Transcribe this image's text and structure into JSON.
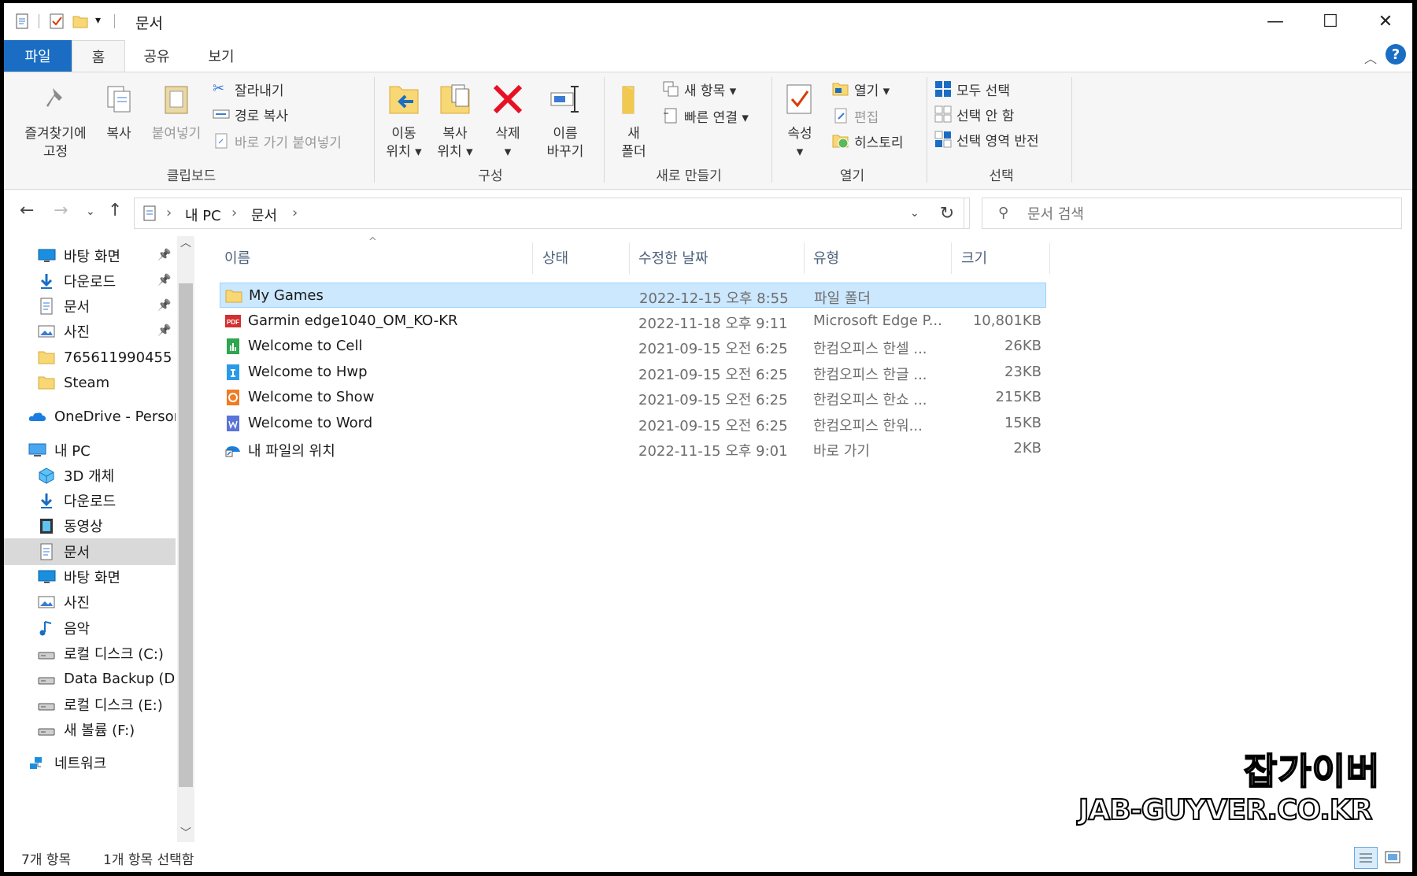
{
  "window": {
    "title": "문서",
    "minimize": "—",
    "maximize": "☐",
    "close": "✕"
  },
  "tabs": {
    "file": "파일",
    "home": "홈",
    "share": "공유",
    "view": "보기"
  },
  "ribbon": {
    "clipboard": {
      "label": "클립보드",
      "pin_line1": "즐겨찾기에",
      "pin_line2": "고정",
      "copy": "복사",
      "paste": "붙여넣기",
      "cut": "잘라내기",
      "copy_path": "경로 복사",
      "paste_shortcut": "바로 가기 붙여넣기"
    },
    "organize": {
      "label": "구성",
      "move_line1": "이동",
      "move_line2": "위치 ▾",
      "copyto_line1": "복사",
      "copyto_line2": "위치 ▾",
      "delete": "삭제",
      "delete_arrow": "▾",
      "rename_line1": "이름",
      "rename_line2": "바꾸기"
    },
    "new": {
      "label": "새로 만들기",
      "folder_line1": "새",
      "folder_line2": "폴더",
      "new_item": "새 항목 ▾",
      "easy_access": "빠른 연결 ▾"
    },
    "open": {
      "label": "열기",
      "properties": "속성",
      "properties_arrow": "▾",
      "open": "열기 ▾",
      "edit": "편집",
      "history": "히스토리"
    },
    "select": {
      "label": "선택",
      "select_all": "모두 선택",
      "select_none": "선택 안 함",
      "invert": "선택 영역 반전"
    }
  },
  "address": {
    "crumbs": [
      "내 PC",
      "문서"
    ],
    "search_placeholder": "문서 검색"
  },
  "nav_pane": [
    {
      "label": "바탕 화면",
      "icon": "desktop-icon",
      "pinned": true
    },
    {
      "label": "다운로드",
      "icon": "download-icon",
      "pinned": true
    },
    {
      "label": "문서",
      "icon": "document-icon",
      "pinned": true
    },
    {
      "label": "사진",
      "icon": "picture-icon",
      "pinned": true
    },
    {
      "label": "765611990455",
      "icon": "folder-icon",
      "pinned": false
    },
    {
      "label": "Steam",
      "icon": "folder-icon",
      "pinned": false
    },
    {
      "label": "OneDrive - Personal",
      "icon": "onedrive-icon",
      "pinned": false
    },
    {
      "label": "내 PC",
      "icon": "pc-icon",
      "pinned": false
    },
    {
      "label": "3D 개체",
      "icon": "3d-objects-icon",
      "pinned": false
    },
    {
      "label": "다운로드",
      "icon": "download-icon",
      "pinned": false
    },
    {
      "label": "동영상",
      "icon": "video-icon",
      "pinned": false
    },
    {
      "label": "문서",
      "icon": "document-icon",
      "pinned": false,
      "selected": true
    },
    {
      "label": "바탕 화면",
      "icon": "desktop-icon",
      "pinned": false
    },
    {
      "label": "사진",
      "icon": "picture-icon",
      "pinned": false
    },
    {
      "label": "음악",
      "icon": "music-icon",
      "pinned": false
    },
    {
      "label": "로컬 디스크 (C:)",
      "icon": "drive-icon",
      "pinned": false
    },
    {
      "label": "Data Backup (D:)",
      "icon": "drive-icon",
      "pinned": false
    },
    {
      "label": "로컬 디스크 (E:)",
      "icon": "drive-icon",
      "pinned": false
    },
    {
      "label": "새 볼륨 (F:)",
      "icon": "drive-icon",
      "pinned": false
    },
    {
      "label": "네트워크",
      "icon": "network-icon",
      "pinned": false
    }
  ],
  "columns": {
    "name": "이름",
    "status": "상태",
    "modified": "수정한 날짜",
    "type": "유형",
    "size": "크기"
  },
  "files": [
    {
      "name": "My Games",
      "modified": "2022-12-15 오후 8:55",
      "type": "파일 폴더",
      "size": "",
      "icon": "folder-icon",
      "selected": true
    },
    {
      "name": "Garmin edge1040_OM_KO-KR",
      "modified": "2022-11-18 오후 9:11",
      "type": "Microsoft Edge P...",
      "size": "10,801KB",
      "icon": "pdf-icon"
    },
    {
      "name": "Welcome to Cell",
      "modified": "2021-09-15 오전 6:25",
      "type": "한컴오피스 한셀 ...",
      "size": "26KB",
      "icon": "hancell-icon"
    },
    {
      "name": "Welcome to Hwp",
      "modified": "2021-09-15 오전 6:25",
      "type": "한컴오피스 한글 ...",
      "size": "23KB",
      "icon": "hwp-icon"
    },
    {
      "name": "Welcome to Show",
      "modified": "2021-09-15 오전 6:25",
      "type": "한컴오피스 한쇼 ...",
      "size": "215KB",
      "icon": "hanshow-icon"
    },
    {
      "name": "Welcome to Word",
      "modified": "2021-09-15 오전 6:25",
      "type": "한컴오피스 한워...",
      "size": "15KB",
      "icon": "hanword-icon"
    },
    {
      "name": "내 파일의 위치",
      "modified": "2022-11-15 오후 9:01",
      "type": "바로 가기",
      "size": "2KB",
      "icon": "shortcut-icon"
    }
  ],
  "status": {
    "count": "7개 항목",
    "selected": "1개 항목 선택함"
  },
  "watermark": {
    "line1": "잡가이버",
    "line2": "JAB-GUYVER.CO.KR"
  },
  "colors": {
    "accent": "#1a6dc2",
    "selection": "#cce8ff",
    "folder": "#f8d775"
  }
}
